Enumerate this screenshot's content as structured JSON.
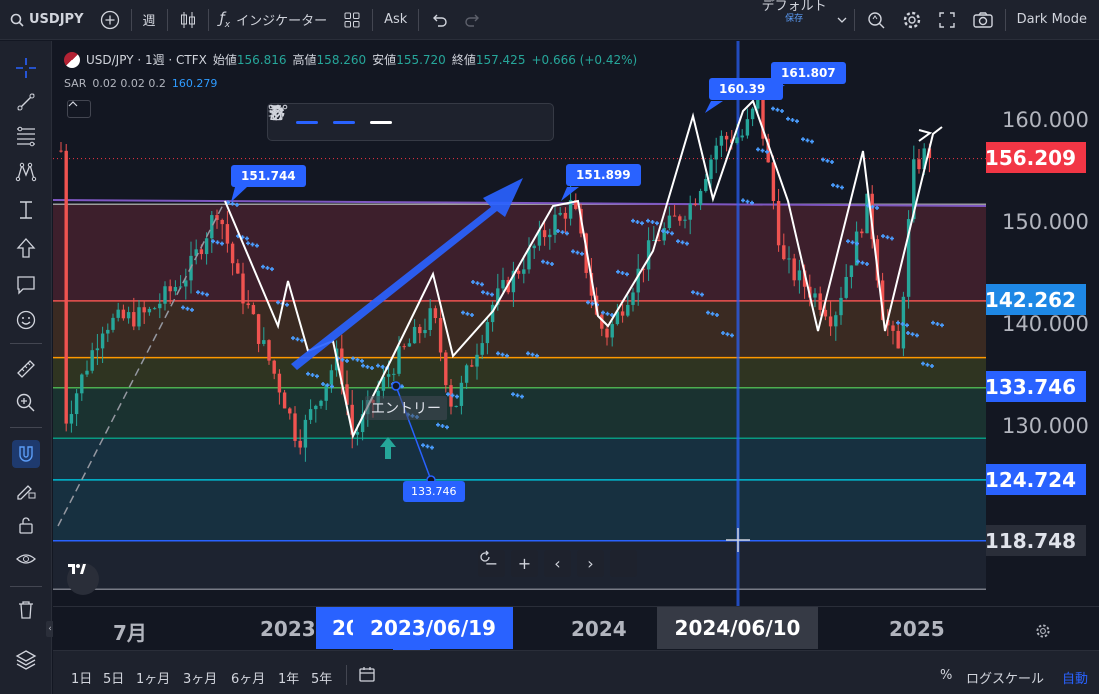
{
  "topbar": {
    "symbol": "USDJPY",
    "interval": "週",
    "indicators_label": "インジケーター",
    "price_type": "Ask",
    "layout_name": "デフォルト",
    "layout_status": "保存",
    "theme_label": "Dark Mode"
  },
  "legend": {
    "title": "USD/JPY · 1週 · CTFX",
    "open_label": "始値",
    "open": "156.816",
    "high_label": "高値",
    "high": "158.260",
    "low_label": "安値",
    "low": "155.720",
    "close_label": "終値",
    "close": "157.425",
    "change": "+0.666 (+0.42%)",
    "sar_label": "SAR",
    "sar_params": "0.02 0.02 0.2",
    "sar_value": "160.279"
  },
  "annotations": {
    "callouts": [
      "151.744",
      "151.899",
      "160.39",
      "161.807"
    ],
    "entry_text": "エントリー",
    "measure_value": "133.746"
  },
  "price_scale": {
    "ticks": [
      "160.000",
      "150.000",
      "140.000",
      "130.000"
    ],
    "badges": [
      "156.209",
      "142.262",
      "133.746",
      "124.724",
      "118.748"
    ]
  },
  "time_axis": {
    "ticks": [
      "7月",
      "2023",
      "20",
      "2024",
      "2025"
    ],
    "crosshair_date_1": "2023/06/19",
    "crosshair_date_2": "2024/06/10"
  },
  "bottom_bar": {
    "ranges": [
      "1日",
      "5日",
      "1ヶ月",
      "3ヶ月",
      "6ヶ月",
      "1年",
      "5年"
    ],
    "percent": "%",
    "log_scale": "ログスケール",
    "auto": "自動"
  },
  "nav": {
    "zoom_out": "−",
    "zoom_in": "+",
    "left": "‹",
    "right": "›"
  },
  "colors": {
    "up": "#26a69a",
    "down": "#ef5350",
    "sar": "#4a9dff",
    "accent": "#2962ff",
    "current_price": "#f23645"
  },
  "chart_data": {
    "type": "candlestick",
    "symbol": "USD/JPY",
    "timeframe": "1週",
    "ylim": [
      113,
      167
    ],
    "fib_levels": [
      151.744,
      142.262,
      136.7,
      133.746,
      128.8,
      124.724,
      118.748,
      114.0
    ],
    "current_price": 156.209,
    "indicator": "SAR",
    "swing_callouts": [
      151.744,
      151.899,
      160.39,
      161.807
    ]
  }
}
